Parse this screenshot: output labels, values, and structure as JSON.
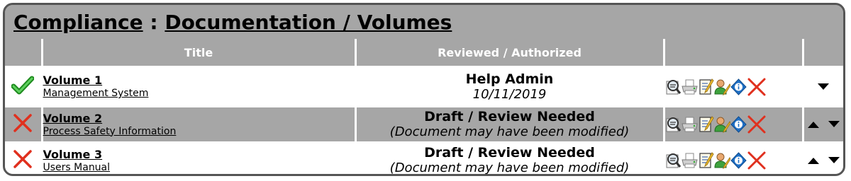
{
  "header": {
    "section": "Compliance",
    "separator": " : ",
    "page": "Documentation / Volumes"
  },
  "columns": {
    "status": "",
    "title": "Title",
    "reviewed": "Reviewed / Authorized",
    "actions": "",
    "order": ""
  },
  "rows": [
    {
      "status": "approved",
      "name": "Volume 1",
      "subtitle": "Management System",
      "review_main": "Help Admin",
      "review_sub": "10/11/2019",
      "can_move_up": false,
      "can_move_down": true
    },
    {
      "status": "rejected",
      "name": "Volume 2",
      "subtitle": "Process Safety Information",
      "review_main": "Draft / Review Needed",
      "review_sub": "(Document may have been modified)",
      "can_move_up": true,
      "can_move_down": true
    },
    {
      "status": "rejected",
      "name": "Volume 3",
      "subtitle": "Users Manual",
      "review_main": "Draft / Review Needed",
      "review_sub": "(Document may have been modified)",
      "can_move_up": true,
      "can_move_down": true
    }
  ],
  "action_icons": [
    "view-icon",
    "print-icon",
    "edit-icon",
    "user-edit-icon",
    "info-icon",
    "delete-icon"
  ],
  "colors": {
    "accent_gray": "#a6a6a6",
    "check_green": "#2ea82e",
    "cross_red": "#e0301e",
    "info_blue": "#1f6fc4"
  }
}
